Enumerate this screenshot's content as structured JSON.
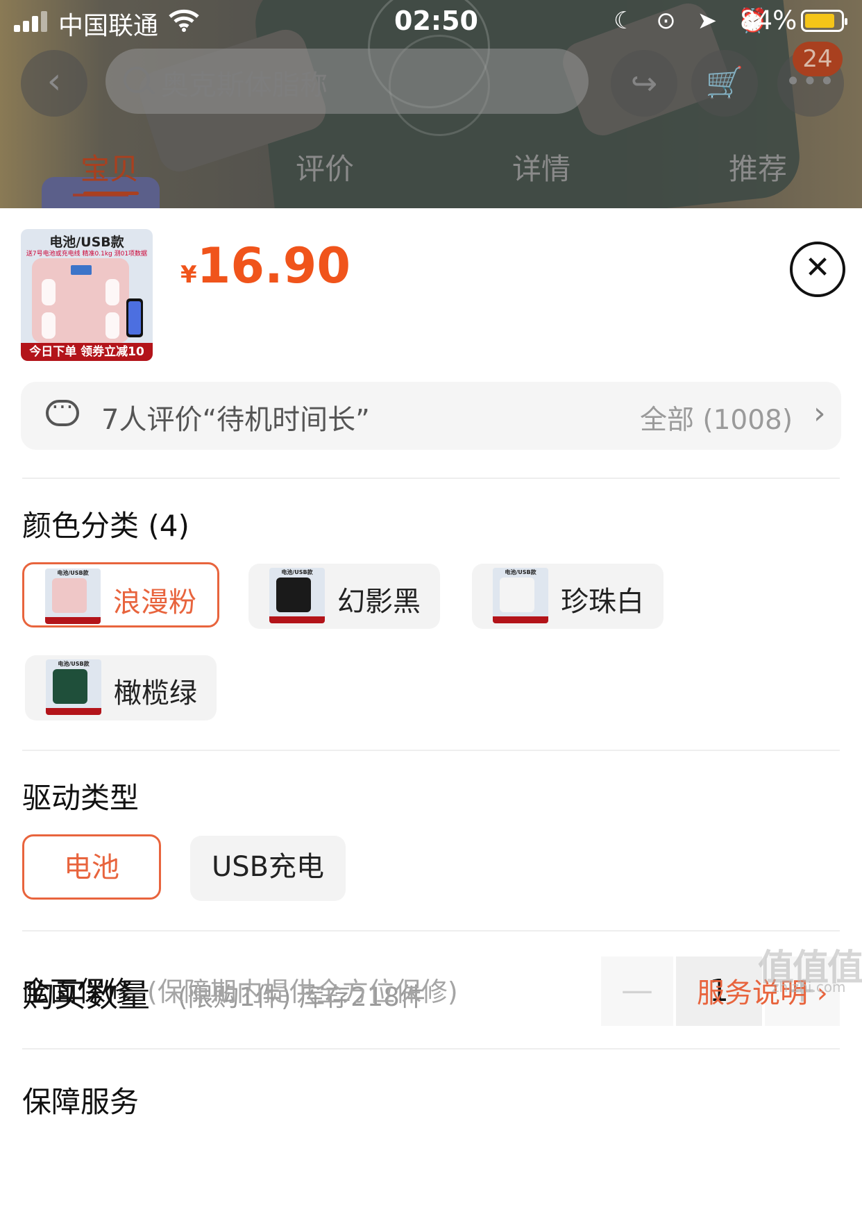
{
  "status": {
    "carrier": "中国联通",
    "time": "02:50",
    "battery_pct": "84%",
    "icons": "☾ ⊙ ➤ ⏰",
    "battery_color": "#f5c518"
  },
  "header": {
    "search_placeholder": "奥克斯体脂称",
    "cart_badge": "24",
    "back_icon": "‹",
    "share_icon": "↪",
    "cart_icon": "🛒",
    "more_icon": "•••"
  },
  "tabs": [
    {
      "label": "宝贝",
      "active": true
    },
    {
      "label": "评价",
      "active": false
    },
    {
      "label": "详情",
      "active": false
    },
    {
      "label": "推荐",
      "active": false
    }
  ],
  "product": {
    "thumb_title": "电池/USB款",
    "thumb_sub": "送7号电池或充电线 精准0.1kg 测01项数据",
    "thumb_display": "48.6",
    "thumb_strip": "今日下单 领券立减10",
    "currency": "¥",
    "price": "16.90",
    "close_icon": "✕"
  },
  "review": {
    "text": "7人评价“待机时间长”",
    "count": "全部 (1008)",
    "arrow": "›"
  },
  "color_section": {
    "title": "颜色分类 (4)",
    "options": [
      {
        "label": "浪漫粉",
        "swatch": "#efc7c7",
        "selected": true
      },
      {
        "label": "幻影黑",
        "swatch": "#1a1a1a",
        "selected": false
      },
      {
        "label": "珍珠白",
        "swatch": "#f4f4f4",
        "selected": false
      },
      {
        "label": "橄榄绿",
        "swatch": "#1f4f3a",
        "selected": false
      }
    ],
    "thumb_title": "电池/USB款"
  },
  "drive_section": {
    "title": "驱动类型",
    "options": [
      {
        "label": "电池",
        "selected": true
      },
      {
        "label": "USB充电",
        "selected": false
      }
    ]
  },
  "quantity": {
    "label": "购买数量",
    "note": "(限购1件) 库存218件",
    "minus": "—",
    "value": "1",
    "plus": "+"
  },
  "service": {
    "title": "保障服务",
    "item": "全面保修",
    "note": "(保障期内提供全方位保修)",
    "link": "服务说明 ›"
  },
  "watermark": {
    "text": "值值值",
    "sub": "zhizhi.com"
  },
  "colors": {
    "accent": "#f0541b",
    "selected_border": "#e8643d"
  }
}
